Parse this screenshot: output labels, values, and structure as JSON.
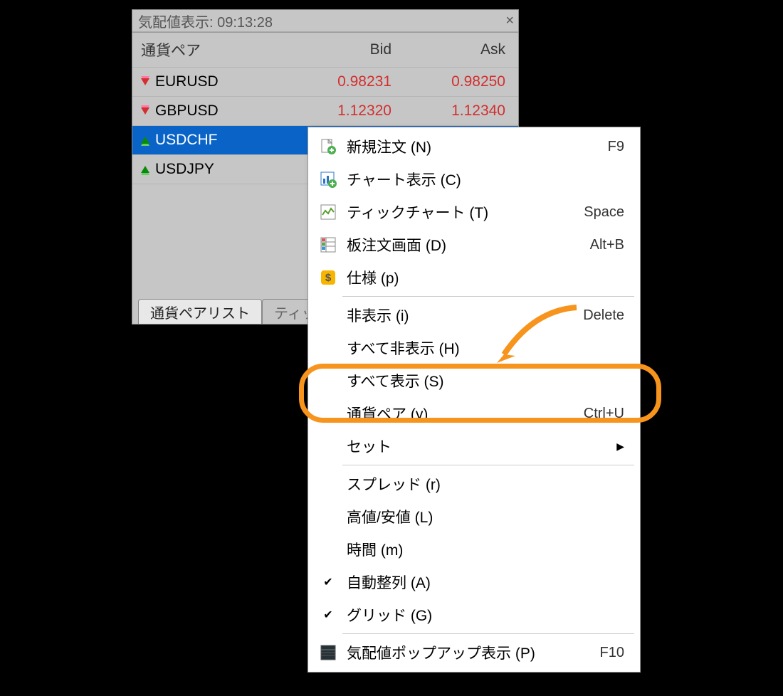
{
  "panel": {
    "title": "気配値表示: 09:13:28",
    "header": {
      "pair": "通貨ペア",
      "bid": "Bid",
      "ask": "Ask"
    },
    "rows": [
      {
        "dir": "down",
        "symbol": "EURUSD",
        "bid": "0.98231",
        "ask": "0.98250",
        "selected": false
      },
      {
        "dir": "down",
        "symbol": "GBPUSD",
        "bid": "1.12320",
        "ask": "1.12340",
        "selected": false
      },
      {
        "dir": "up",
        "symbol": "USDCHF",
        "bid": "",
        "ask": "",
        "selected": true
      },
      {
        "dir": "up",
        "symbol": "USDJPY",
        "bid": "",
        "ask": "",
        "selected": false
      }
    ],
    "tabs": {
      "active": "通貨ペアリスト",
      "inactive": "ティッ"
    }
  },
  "menu": {
    "groups": [
      [
        {
          "icon": "doc-plus",
          "label": "新規注文 (N)",
          "shortcut": "F9"
        },
        {
          "icon": "chart-plus",
          "label": "チャート表示 (C)",
          "shortcut": ""
        },
        {
          "icon": "tick",
          "label": "ティックチャート (T)",
          "shortcut": "Space"
        },
        {
          "icon": "dom",
          "label": "板注文画面 (D)",
          "shortcut": "Alt+B"
        },
        {
          "icon": "spec",
          "label": "仕様 (p)",
          "shortcut": ""
        }
      ],
      [
        {
          "icon": "",
          "label": "非表示 (i)",
          "shortcut": "Delete"
        },
        {
          "icon": "",
          "label": "すべて非表示 (H)",
          "shortcut": ""
        },
        {
          "icon": "",
          "label": "すべて表示 (S)",
          "shortcut": "",
          "highlighted": true
        },
        {
          "icon": "",
          "label": "通貨ペア (y)",
          "shortcut": "Ctrl+U"
        },
        {
          "icon": "",
          "label": "セット",
          "submenu": true
        }
      ],
      [
        {
          "icon": "",
          "label": "スプレッド (r)",
          "shortcut": ""
        },
        {
          "icon": "",
          "label": "高値/安値 (L)",
          "shortcut": ""
        },
        {
          "icon": "",
          "label": "時間 (m)",
          "shortcut": ""
        },
        {
          "icon": "",
          "checked": true,
          "label": "自動整列 (A)",
          "shortcut": ""
        },
        {
          "icon": "",
          "checked": true,
          "label": "グリッド (G)",
          "shortcut": ""
        }
      ],
      [
        {
          "icon": "popup",
          "label": "気配値ポップアップ表示 (P)",
          "shortcut": "F10"
        }
      ]
    ]
  }
}
